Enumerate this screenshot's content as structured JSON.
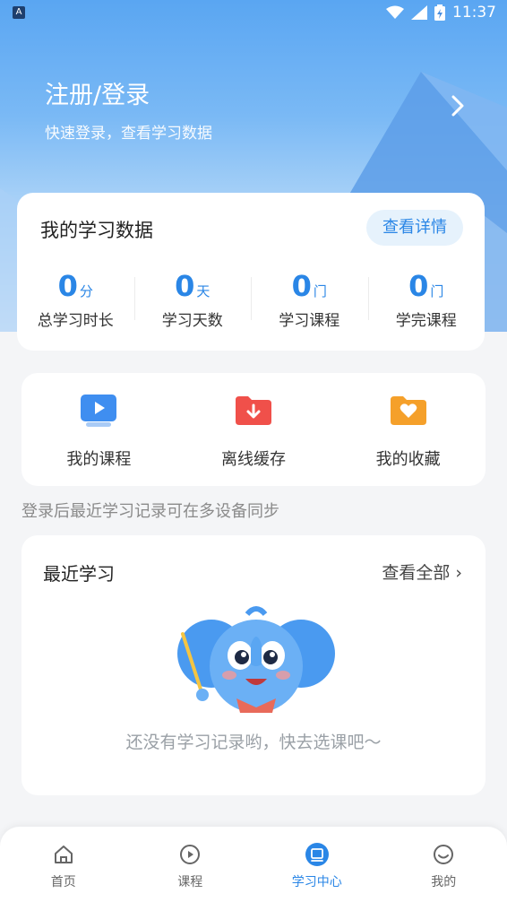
{
  "status_bar": {
    "time": "11:37",
    "app_badge": "A"
  },
  "login": {
    "title": "注册/登录",
    "subtitle": "快速登录，查看学习数据"
  },
  "stats": {
    "title": "我的学习数据",
    "detail_label": "查看详情",
    "items": [
      {
        "value": "0",
        "unit": "分",
        "label": "总学习时长"
      },
      {
        "value": "0",
        "unit": "天",
        "label": "学习天数"
      },
      {
        "value": "0",
        "unit": "门",
        "label": "学习课程"
      },
      {
        "value": "0",
        "unit": "门",
        "label": "学完课程"
      }
    ]
  },
  "menu": {
    "items": [
      {
        "label": "我的课程",
        "icon": "play-screen-icon",
        "color": "#3f8ef0"
      },
      {
        "label": "离线缓存",
        "icon": "download-folder-icon",
        "color": "#f0504a"
      },
      {
        "label": "我的收藏",
        "icon": "heart-folder-icon",
        "color": "#f5a02a"
      }
    ]
  },
  "sync_note": "登录后最近学习记录可在多设备同步",
  "recent": {
    "title": "最近学习",
    "view_all": "查看全部",
    "empty_text": "还没有学习记录哟，快去选课吧～"
  },
  "tabbar": {
    "tabs": [
      {
        "label": "首页",
        "icon": "home-icon",
        "active": false
      },
      {
        "label": "课程",
        "icon": "play-circle-icon",
        "active": false
      },
      {
        "label": "学习中心",
        "icon": "book-icon",
        "active": true
      },
      {
        "label": "我的",
        "icon": "profile-icon",
        "active": false
      }
    ]
  },
  "colors": {
    "accent": "#2a86e6",
    "hero_top": "#5aa6f2"
  }
}
